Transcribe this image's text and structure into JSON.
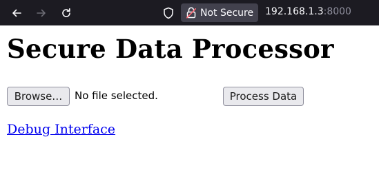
{
  "browser": {
    "security_label": "Not Secure",
    "url_host": "192.168.1.3",
    "url_port": ":8000",
    "icons": {
      "back": "arrow-left-icon",
      "forward": "arrow-right-icon",
      "reload": "reload-icon",
      "shield": "shield-icon",
      "lock": "broken-lock-icon"
    }
  },
  "page": {
    "title": "Secure Data Processor",
    "file_input": {
      "browse_label": "Browse…",
      "status": "No file selected."
    },
    "process_button_label": "Process Data",
    "debug_link_label": "Debug Interface"
  }
}
